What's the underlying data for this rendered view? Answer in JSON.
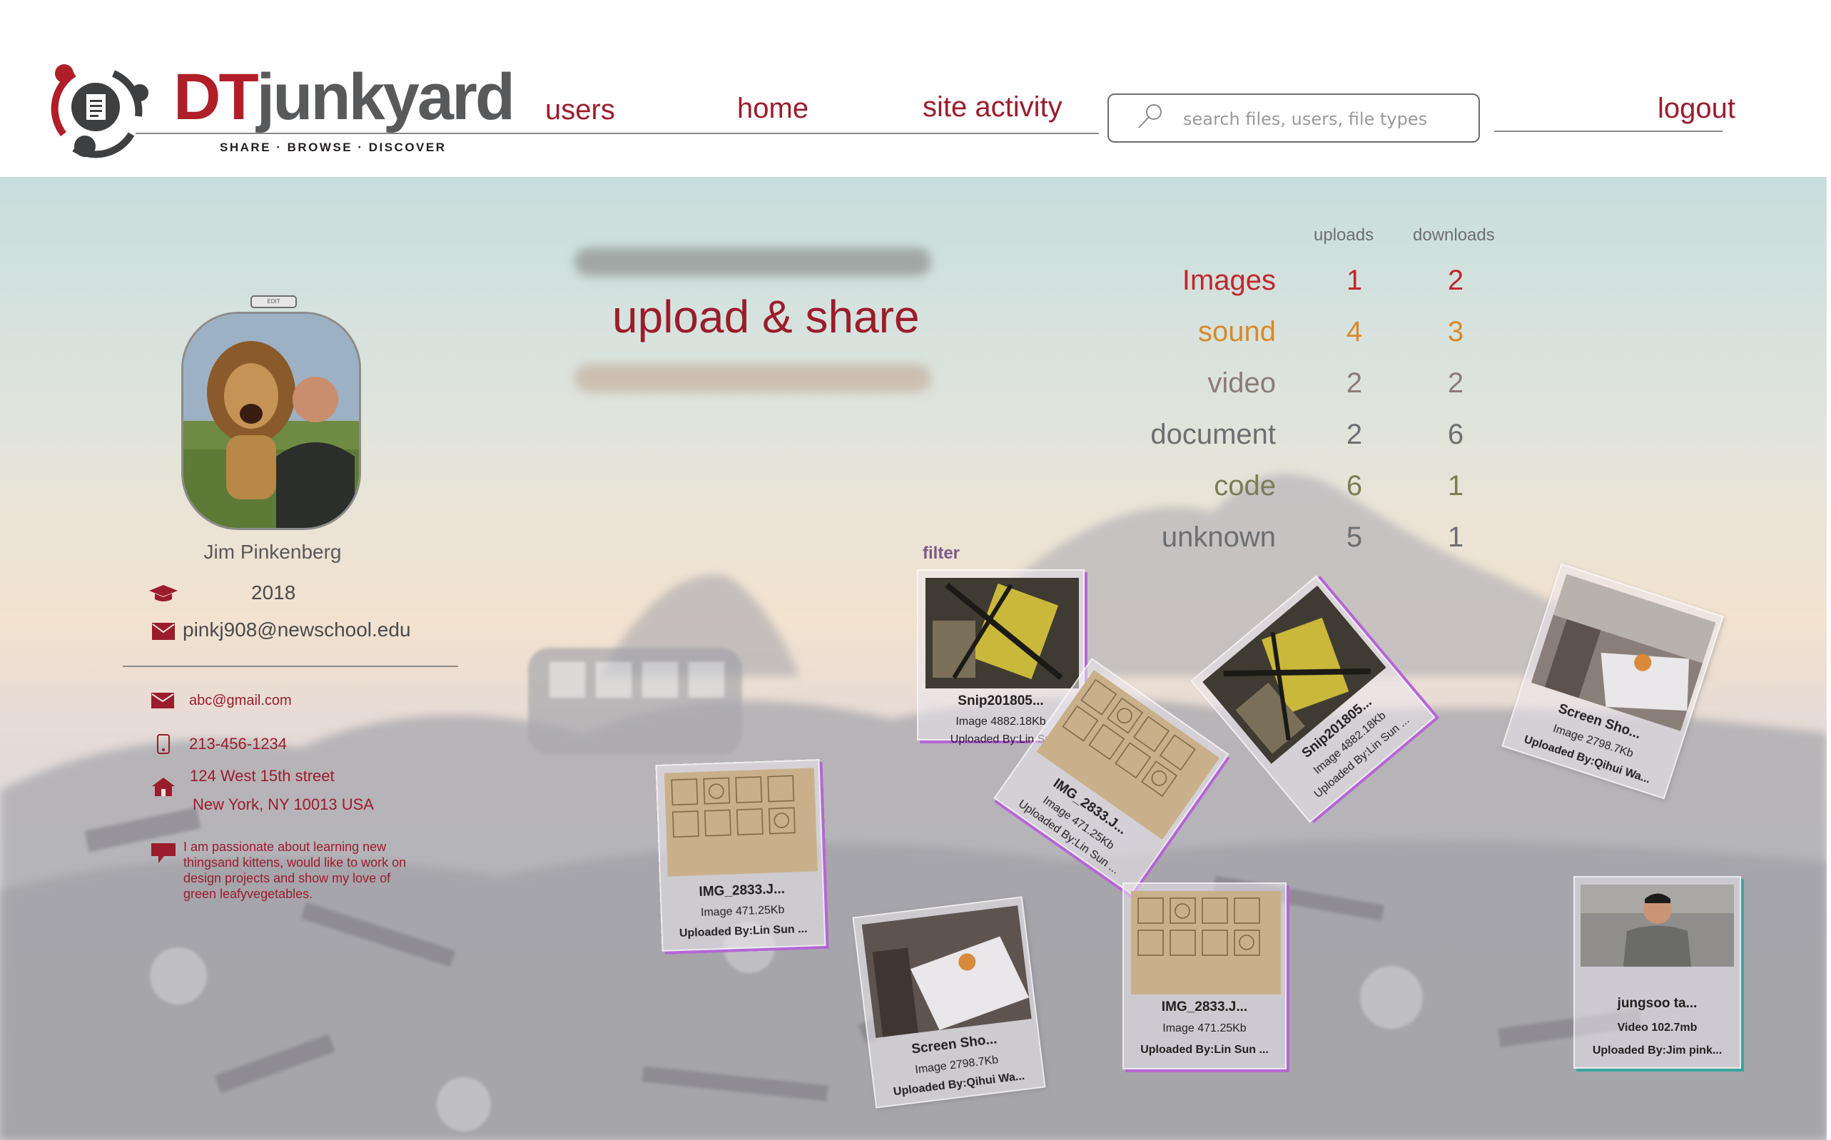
{
  "header": {
    "logo_dt": "DT",
    "logo_junkyard": "junkyard",
    "tagline": "SHARE · BROWSE · DISCOVER",
    "nav": {
      "users": "users",
      "home": "home",
      "site_activity": "site activity",
      "logout": "logout"
    },
    "search": {
      "placeholder": "search files, users, file types",
      "value": ""
    }
  },
  "profile": {
    "edit_label": "EDIT",
    "name": "Jim Pinkenberg",
    "year": "2018",
    "email": "pinkj908@newschool.edu",
    "contact": {
      "email": "abc@gmail.com",
      "phone": "213-456-1234",
      "address_line1": "124 West 15th street",
      "address_line2": "New York, NY 10013 USA",
      "bio": "I am passionate about learning new thingsand kittens, would like to work on design projects and show my love of green leafyvegetables."
    }
  },
  "upload": {
    "title": "upload & share"
  },
  "stats": {
    "headers": {
      "uploads": "uploads",
      "downloads": "downloads"
    },
    "rows": [
      {
        "label": "Images",
        "uploads": "1",
        "downloads": "2",
        "color": "#c0272d"
      },
      {
        "label": "sound",
        "uploads": "4",
        "downloads": "3",
        "color": "#d8892a"
      },
      {
        "label": "video",
        "uploads": "2",
        "downloads": "2",
        "color": "#8c7b78"
      },
      {
        "label": "document",
        "uploads": "2",
        "downloads": "6",
        "color": "#6d6e71"
      },
      {
        "label": "code",
        "uploads": "6",
        "downloads": "1",
        "color": "#7a7d55"
      },
      {
        "label": "unknown",
        "uploads": "5",
        "downloads": "1",
        "color": "#6d6e71"
      }
    ]
  },
  "filter_label": "filter",
  "cards": [
    {
      "title": "Snip201805...",
      "meta": "Image 4882.18Kb",
      "uploader": "Uploaded By:Lin Su"
    },
    {
      "title": "IMG_2833.J...",
      "meta": "Image 471.25Kb",
      "uploader": "Uploaded By:Lin Sun ..."
    },
    {
      "title": "IMG_2833.J...",
      "meta": "Image 471.25Kb",
      "uploader": "Uploaded By:Lin Sun ..."
    },
    {
      "title": "Snip201805...",
      "meta": "Image 4882.18Kb",
      "uploader": "Uploaded By:Lin Sun ..."
    },
    {
      "title": "Screen Sho...",
      "meta": "Image 2798.7Kb",
      "uploader": "Uploaded By:Qihui Wa..."
    },
    {
      "title": "Screen Sho...",
      "meta": "Image 2798.7Kb",
      "uploader": "Uploaded By:Qihui Wa..."
    },
    {
      "title": "IMG_2833.J...",
      "meta": "Image 471.25Kb",
      "uploader": "Uploaded By:Lin Sun ..."
    },
    {
      "title": "jungsoo ta...",
      "meta": "Video 102.7mb",
      "uploader": "Uploaded By:Jim pink..."
    }
  ]
}
